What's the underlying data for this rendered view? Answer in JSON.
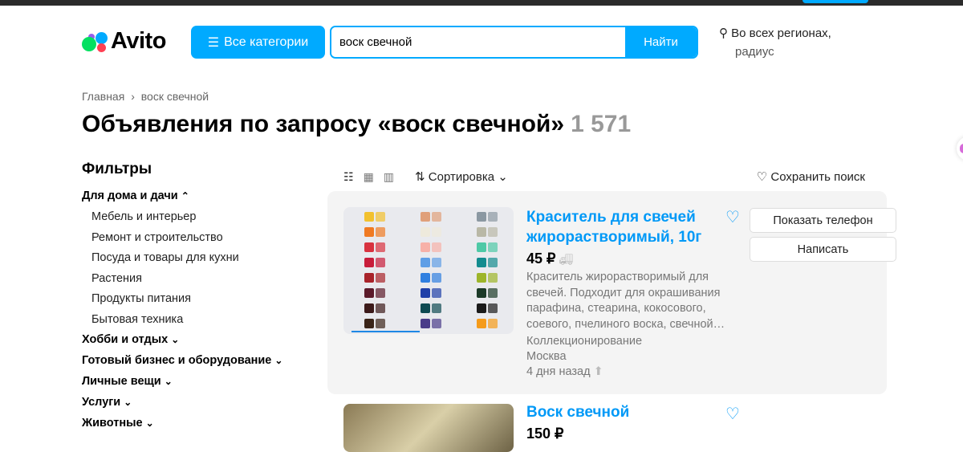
{
  "header": {
    "logo": "Avito",
    "categories_button": "Все категории",
    "search_value": "воск свечной",
    "search_button": "Найти",
    "region_line1": "Во всех регионах,",
    "region_line2": "радиус"
  },
  "breadcrumb": {
    "home": "Главная",
    "separator": "›",
    "current": "воск свечной"
  },
  "page": {
    "title": "Объявления по запросу «воск свечной»",
    "count": "1 571"
  },
  "filters": {
    "heading": "Фильтры",
    "groups": [
      {
        "label": "Для дома и дачи",
        "chevron": "⌃",
        "items": [
          "Мебель и интерьер",
          "Ремонт и строительство",
          "Посуда и товары для кухни",
          "Растения",
          "Продукты питания",
          "Бытовая техника"
        ]
      },
      {
        "label": "Хобби и отдых",
        "chevron": "⌄"
      },
      {
        "label": "Готовый бизнес и оборудование",
        "chevron": "⌄"
      },
      {
        "label": "Личные вещи",
        "chevron": "⌄"
      },
      {
        "label": "Услуги",
        "chevron": "⌄"
      },
      {
        "label": "Животные",
        "chevron": "⌄"
      }
    ]
  },
  "toolbar": {
    "sort": "Сортировка",
    "save_search": "Сохранить поиск"
  },
  "listings": [
    {
      "title": "Краситель для свечей жирорастворимый, 10г",
      "price": "45 ₽",
      "description": "Краситель жирорастворимый для свечей. Подходит для окрашивания парафина, стеарина, кокосового, соевого, пчелиного воска, свечной…",
      "category": "Коллекционирование",
      "city": "Москва",
      "date": "4 дня назад",
      "show_phone": "Показать телефон",
      "message": "Написать"
    },
    {
      "title": "Воск свечной",
      "price": "150 ₽"
    }
  ],
  "colors": {
    "accent": "#00aaff",
    "link": "#0099f7",
    "swatches": [
      "#f2c12e",
      "#f07a22",
      "#d8323f",
      "#c81d3a",
      "#a8232a",
      "#5b1a2a",
      "#3c1a1a",
      "#3a2418",
      "#e0a07a",
      "#eeeadc",
      "#f7b1a8",
      "#5f9ee6",
      "#2f7fe0",
      "#2040a8",
      "#0e4a52",
      "#4a3d8a",
      "#8b98a2",
      "#b9b8a6",
      "#4ec9a6",
      "#138c8f",
      "#9db52a",
      "#1b3a28",
      "#1a1a1a",
      "#f59b1a"
    ]
  }
}
